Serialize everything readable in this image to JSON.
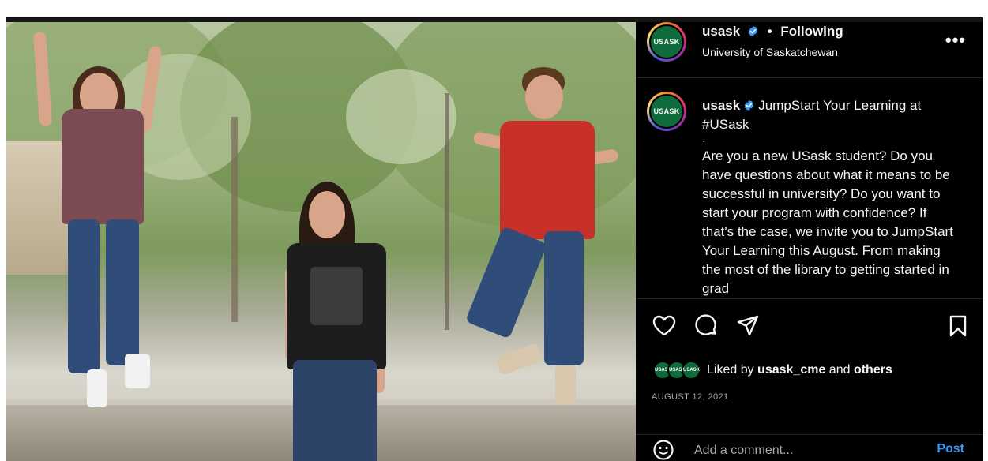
{
  "post": {
    "account": {
      "username": "usask",
      "display_name": "University of Saskatchewan",
      "follow_status": "Following",
      "separator": "•",
      "avatar_text": "USASK",
      "verified": true
    },
    "more_label": "•••",
    "caption": {
      "username": "usask",
      "lines": [
        "JumpStart Your Learning at #USask",
        ".",
        "Are you a new USask student? Do you have questions about what it means to be successful in university? Do you want to start your program with confidence? If that's the case, we invite you to JumpStart Your Learning this August. From making the most of the library to getting started in grad"
      ]
    },
    "likes": {
      "prefix": "Liked by",
      "user": "usask_cme",
      "conjunction": "and",
      "suffix": "others",
      "avatars": [
        "USASK",
        "USASK",
        "USASK"
      ]
    },
    "date": "AUGUST 12, 2021",
    "comment": {
      "placeholder": "Add a comment...",
      "post_label": "Post"
    },
    "icons": {
      "like": "heart-icon",
      "comment": "comment-bubble-icon",
      "share": "paper-plane-icon",
      "save": "bookmark-icon",
      "emoji": "emoji-icon",
      "verified": "verified-badge-icon"
    },
    "colors": {
      "background": "#000000",
      "text": "#f5f5f5",
      "muted": "#a8a8a8",
      "link_blue": "#3797f0",
      "verified_blue": "#3897f0",
      "brand_green": "#0f6b3b"
    }
  }
}
